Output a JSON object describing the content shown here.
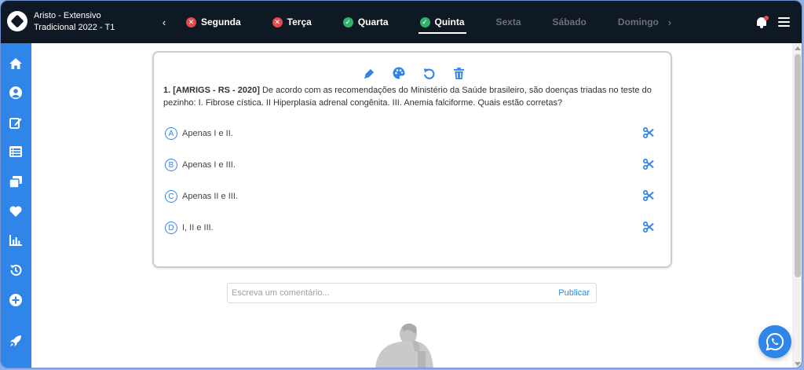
{
  "brand": {
    "line1": "Aristo - Extensivo",
    "line2": "Tradicional 2022 - T1"
  },
  "days": [
    {
      "label": "Segunda",
      "status": "error"
    },
    {
      "label": "Terça",
      "status": "error"
    },
    {
      "label": "Quarta",
      "status": "done"
    },
    {
      "label": "Quinta",
      "status": "done",
      "active": true
    },
    {
      "label": "Sexta",
      "status": "none"
    },
    {
      "label": "Sábado",
      "status": "none"
    },
    {
      "label": "Domingo",
      "status": "none"
    }
  ],
  "colors": {
    "accent": "#2f86e8",
    "topbar": "#0f1923",
    "error": "#e5484d",
    "success": "#2fb36b"
  },
  "question": {
    "number": "1.",
    "source": "[AMRIGS - RS - 2020]",
    "text": "De acordo com as recomendações do Ministério da Saúde brasileiro, são doenças triadas no teste do pezinho: I. Fibrose cística. II Hiperplasia adrenal congênita. III. Anemia falciforme. Quais estão corretas?",
    "options": [
      {
        "letter": "A",
        "text": "Apenas I e II."
      },
      {
        "letter": "B",
        "text": "Apenas I e III."
      },
      {
        "letter": "C",
        "text": "Apenas II e III."
      },
      {
        "letter": "D",
        "text": "I, II e III."
      }
    ]
  },
  "comment": {
    "placeholder": "Escreva um comentário...",
    "publish_label": "Publicar"
  },
  "icons": {
    "sidebar": [
      "home-icon",
      "user-icon",
      "edit-icon",
      "list-icon",
      "cards-icon",
      "heart-icon",
      "chart-icon",
      "history-icon",
      "plus-circle-icon",
      "rocket-icon"
    ],
    "toolbar": [
      "highlighter-icon",
      "palette-icon",
      "undo-icon",
      "trash-icon"
    ]
  }
}
